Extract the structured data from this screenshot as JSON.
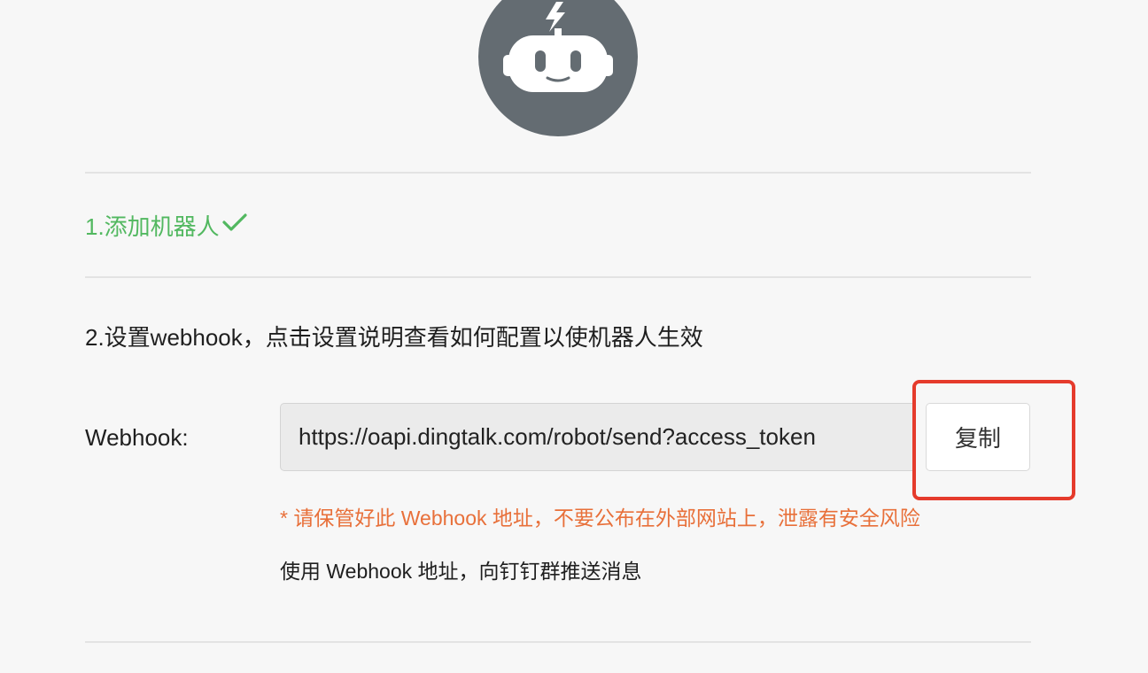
{
  "step1": {
    "label": "1.添加机器人"
  },
  "step2": {
    "label": "2.设置webhook，点击设置说明查看如何配置以使机器人生效"
  },
  "webhook": {
    "label": "Webhook:",
    "value": "https://oapi.dingtalk.com/robot/send?access_token",
    "copy_label": "复制",
    "warning": "* 请保管好此 Webhook 地址，不要公布在外部网站上，泄露有安全风险",
    "hint": "使用 Webhook 地址，向钉钉群推送消息"
  },
  "icons": {
    "avatar": "robot-icon",
    "check": "check-icon"
  },
  "colors": {
    "success": "#52b860",
    "warning": "#e8703a",
    "highlight": "#e53b2c",
    "avatar": "#646c72"
  }
}
